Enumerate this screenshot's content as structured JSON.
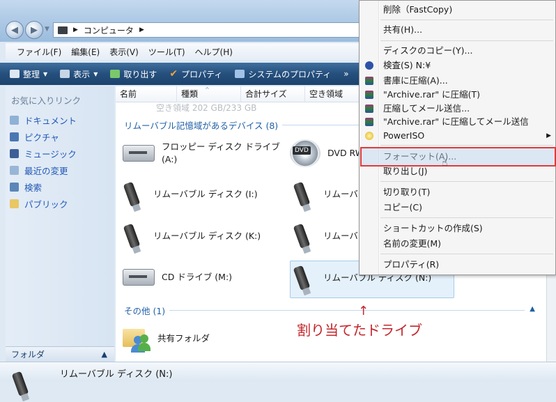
{
  "address": {
    "segments": [
      "コンピュータ"
    ]
  },
  "menubar": [
    "ファイル(F)",
    "編集(E)",
    "表示(V)",
    "ツール(T)",
    "ヘルプ(H)"
  ],
  "toolbar": [
    "整理",
    "表示",
    "取り出す",
    "プロパティ",
    "システムのプロパティ",
    "»"
  ],
  "favorites": {
    "title": "お気に入りリンク",
    "items": [
      "ドキュメント",
      "ピクチャ",
      "ミュージック",
      "最近の変更",
      "検索",
      "パブリック"
    ]
  },
  "folder_bar": "フォルダ",
  "columns": [
    "名前",
    "種類",
    "合計サイズ",
    "空き領域"
  ],
  "faded_row": "空き領域 202 GB/233 GB",
  "groups": {
    "removable": "リムーバブル記憶域があるデバイス (8)",
    "other": "その他 (1)"
  },
  "devices": {
    "floppy_1": "フロッピー ディスク ドライブ",
    "floppy_2": "(A:)",
    "dvd": "DVD RW",
    "disk_i": "リムーバブル ディスク (I:)",
    "disk_i2": "リムーバ",
    "disk_k": "リムーバブル ディスク (K:)",
    "disk_k2": "リムーバ",
    "cd": "CD ドライブ (M:)",
    "disk_n": "リムーバブル ディスク (N:)",
    "shared": "共有フォルダ"
  },
  "annotation": {
    "arrow": "↑",
    "text": "割り当てたドライブ"
  },
  "details": "リムーバブル ディスク (N:)",
  "context_menu": [
    "削除（FastCopy)",
    "共有(H)...",
    "ディスクのコピー(Y)...",
    "検査(S) N:¥",
    "書庫に圧縮(A)...",
    "\"Archive.rar\" に圧縮(T)",
    "圧縮してメール送信...",
    "\"Archive.rar\" に圧縮してメール送信",
    "PowerISO",
    "フォーマット(A)...",
    "取り出し(J)",
    "切り取り(T)",
    "コピー(C)",
    "ショートカットの作成(S)",
    "名前の変更(M)",
    "プロパティ(R)"
  ],
  "colors": {
    "highlight": "#e03a3a",
    "annotation": "#c2262b",
    "link": "#2158b5"
  }
}
